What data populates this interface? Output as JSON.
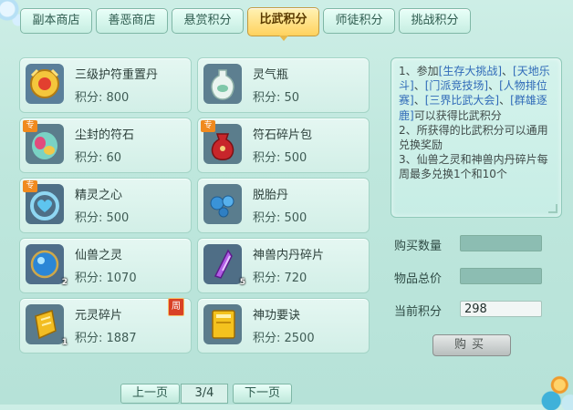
{
  "tabs": [
    {
      "label": "副本商店",
      "active": false
    },
    {
      "label": "善恶商店",
      "active": false
    },
    {
      "label": "悬赏积分",
      "active": false
    },
    {
      "label": "比武积分",
      "active": true
    },
    {
      "label": "师徒积分",
      "active": false
    },
    {
      "label": "挑战积分",
      "active": false
    }
  ],
  "items": [
    {
      "name": "三级护符重置丹",
      "price": "积分: 800",
      "icon": "golden-amulet-icon"
    },
    {
      "name": "灵气瓶",
      "price": "积分: 50",
      "icon": "jade-vase-icon"
    },
    {
      "name": "尘封的符石",
      "price": "积分: 60",
      "icon": "rune-stone-icon",
      "badge": "专"
    },
    {
      "name": "符石碎片包",
      "price": "积分: 500",
      "icon": "rune-pouch-icon",
      "badge": "专"
    },
    {
      "name": "精灵之心",
      "price": "积分: 500",
      "icon": "spirit-heart-icon",
      "badge": "专"
    },
    {
      "name": "脱胎丹",
      "price": "积分: 500",
      "icon": "blue-pills-icon"
    },
    {
      "name": "仙兽之灵",
      "price": "积分: 1070",
      "icon": "beast-orb-icon",
      "count": "2"
    },
    {
      "name": "神兽内丹碎片",
      "price": "积分: 720",
      "icon": "purple-crystal-icon",
      "count": "5"
    },
    {
      "name": "元灵碎片",
      "price": "积分: 1887",
      "icon": "gold-fragment-icon",
      "count": "1",
      "tag": "周"
    },
    {
      "name": "神功要诀",
      "price": "积分: 2500",
      "icon": "golden-book-icon"
    }
  ],
  "info": {
    "p1_a": "1、参加",
    "l1": "[生存大挑战]",
    "c1": "、",
    "l2": "[天地乐斗]",
    "c2": "、",
    "l3": "[门派竞技场]",
    "c3": "、",
    "l4": "[人物排位赛]",
    "c4": "、",
    "l5": "[三界比武大会]",
    "c5": "、",
    "l6": "[群雄逐鹿]",
    "p1_b": "可以获得比武积分",
    "p2": "2、所获得的比武积分可以通用兑换奖励",
    "p3": "3、仙兽之灵和神兽内丹碎片每周最多兑换1个和10个"
  },
  "fields": {
    "qty_label": "购买数量",
    "total_label": "物品总价",
    "current_label": "当前积分",
    "current_value": "298"
  },
  "buy_label": "购买",
  "pager": {
    "prev": "上一页",
    "page": "3/4",
    "next": "下一页"
  }
}
